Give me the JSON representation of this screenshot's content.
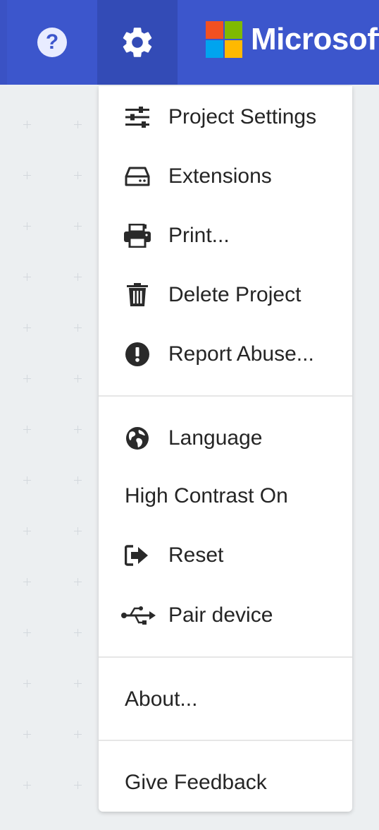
{
  "header": {
    "help_icon": "help-circle-icon",
    "help_glyph": "?",
    "settings_icon": "gear-icon",
    "brand": "Microsoft",
    "brand_colors": [
      "#f25022",
      "#7fba00",
      "#00a4ef",
      "#ffb900"
    ],
    "bar_color": "#3c56cc",
    "active_color": "#334bb6"
  },
  "menu": {
    "items": [
      {
        "label": "Project Settings",
        "icon": "sliders-icon"
      },
      {
        "label": "Extensions",
        "icon": "drive-icon"
      },
      {
        "label": "Print...",
        "icon": "print-icon"
      },
      {
        "label": "Delete Project",
        "icon": "trash-icon"
      },
      {
        "label": "Report Abuse...",
        "icon": "exclamation-circle-icon"
      },
      {
        "label": "Language",
        "icon": "globe-icon"
      },
      {
        "label": "High Contrast On",
        "icon": ""
      },
      {
        "label": "Reset",
        "icon": "sign-out-icon"
      },
      {
        "label": "Pair device",
        "icon": "usb-icon"
      },
      {
        "label": "About...",
        "icon": ""
      },
      {
        "label": "Give Feedback",
        "icon": ""
      }
    ]
  }
}
